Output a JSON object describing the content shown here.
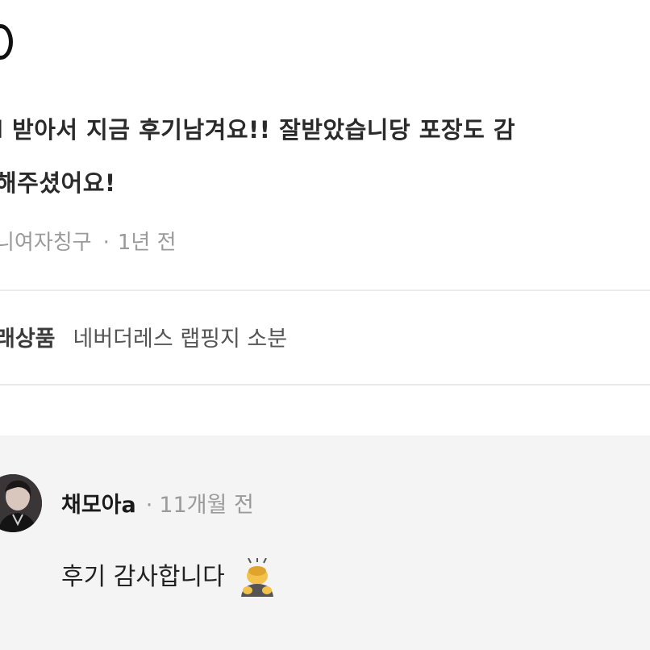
{
  "review": {
    "text_line1": "l 받아서 지금 후기남겨요!! 잘받았습니당 포장도 감",
    "text_line2": "해주셨어요!",
    "author": "니여자칭구",
    "separator": "·",
    "time": "1년 전"
  },
  "product": {
    "label": "래상품",
    "name": "네버더레스 랩핑지 소분"
  },
  "comment": {
    "author": "채모아a",
    "separator": "·",
    "time": "11개월 전",
    "body": "후기 감사합니다",
    "emoji_icon": "person-bowing-icon"
  }
}
